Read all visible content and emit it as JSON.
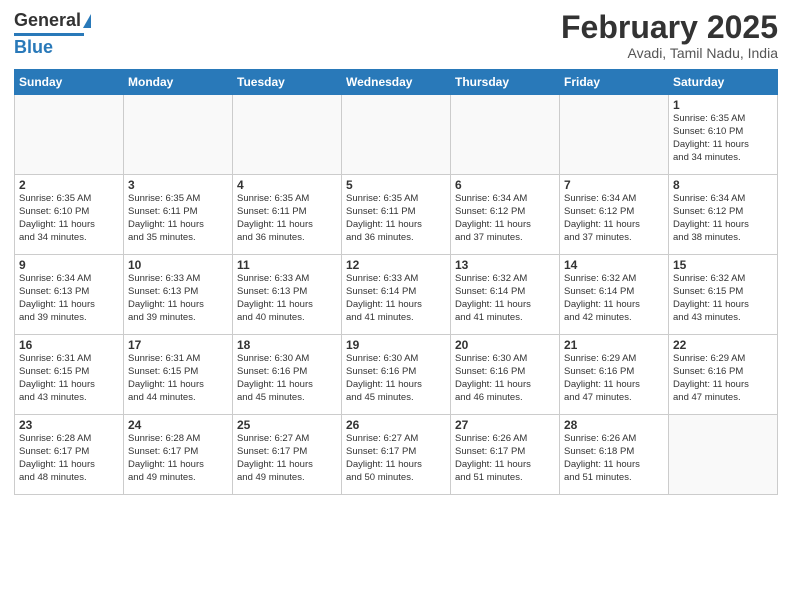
{
  "logo": {
    "general": "General",
    "blue": "Blue"
  },
  "header": {
    "month": "February 2025",
    "location": "Avadi, Tamil Nadu, India"
  },
  "days_of_week": [
    "Sunday",
    "Monday",
    "Tuesday",
    "Wednesday",
    "Thursday",
    "Friday",
    "Saturday"
  ],
  "weeks": [
    [
      {
        "day": "",
        "info": ""
      },
      {
        "day": "",
        "info": ""
      },
      {
        "day": "",
        "info": ""
      },
      {
        "day": "",
        "info": ""
      },
      {
        "day": "",
        "info": ""
      },
      {
        "day": "",
        "info": ""
      },
      {
        "day": "1",
        "info": "Sunrise: 6:35 AM\nSunset: 6:10 PM\nDaylight: 11 hours\nand 34 minutes."
      }
    ],
    [
      {
        "day": "2",
        "info": "Sunrise: 6:35 AM\nSunset: 6:10 PM\nDaylight: 11 hours\nand 34 minutes."
      },
      {
        "day": "3",
        "info": "Sunrise: 6:35 AM\nSunset: 6:11 PM\nDaylight: 11 hours\nand 35 minutes."
      },
      {
        "day": "4",
        "info": "Sunrise: 6:35 AM\nSunset: 6:11 PM\nDaylight: 11 hours\nand 36 minutes."
      },
      {
        "day": "5",
        "info": "Sunrise: 6:35 AM\nSunset: 6:11 PM\nDaylight: 11 hours\nand 36 minutes."
      },
      {
        "day": "6",
        "info": "Sunrise: 6:34 AM\nSunset: 6:12 PM\nDaylight: 11 hours\nand 37 minutes."
      },
      {
        "day": "7",
        "info": "Sunrise: 6:34 AM\nSunset: 6:12 PM\nDaylight: 11 hours\nand 37 minutes."
      },
      {
        "day": "8",
        "info": "Sunrise: 6:34 AM\nSunset: 6:12 PM\nDaylight: 11 hours\nand 38 minutes."
      }
    ],
    [
      {
        "day": "9",
        "info": "Sunrise: 6:34 AM\nSunset: 6:13 PM\nDaylight: 11 hours\nand 39 minutes."
      },
      {
        "day": "10",
        "info": "Sunrise: 6:33 AM\nSunset: 6:13 PM\nDaylight: 11 hours\nand 39 minutes."
      },
      {
        "day": "11",
        "info": "Sunrise: 6:33 AM\nSunset: 6:13 PM\nDaylight: 11 hours\nand 40 minutes."
      },
      {
        "day": "12",
        "info": "Sunrise: 6:33 AM\nSunset: 6:14 PM\nDaylight: 11 hours\nand 41 minutes."
      },
      {
        "day": "13",
        "info": "Sunrise: 6:32 AM\nSunset: 6:14 PM\nDaylight: 11 hours\nand 41 minutes."
      },
      {
        "day": "14",
        "info": "Sunrise: 6:32 AM\nSunset: 6:14 PM\nDaylight: 11 hours\nand 42 minutes."
      },
      {
        "day": "15",
        "info": "Sunrise: 6:32 AM\nSunset: 6:15 PM\nDaylight: 11 hours\nand 43 minutes."
      }
    ],
    [
      {
        "day": "16",
        "info": "Sunrise: 6:31 AM\nSunset: 6:15 PM\nDaylight: 11 hours\nand 43 minutes."
      },
      {
        "day": "17",
        "info": "Sunrise: 6:31 AM\nSunset: 6:15 PM\nDaylight: 11 hours\nand 44 minutes."
      },
      {
        "day": "18",
        "info": "Sunrise: 6:30 AM\nSunset: 6:16 PM\nDaylight: 11 hours\nand 45 minutes."
      },
      {
        "day": "19",
        "info": "Sunrise: 6:30 AM\nSunset: 6:16 PM\nDaylight: 11 hours\nand 45 minutes."
      },
      {
        "day": "20",
        "info": "Sunrise: 6:30 AM\nSunset: 6:16 PM\nDaylight: 11 hours\nand 46 minutes."
      },
      {
        "day": "21",
        "info": "Sunrise: 6:29 AM\nSunset: 6:16 PM\nDaylight: 11 hours\nand 47 minutes."
      },
      {
        "day": "22",
        "info": "Sunrise: 6:29 AM\nSunset: 6:16 PM\nDaylight: 11 hours\nand 47 minutes."
      }
    ],
    [
      {
        "day": "23",
        "info": "Sunrise: 6:28 AM\nSunset: 6:17 PM\nDaylight: 11 hours\nand 48 minutes."
      },
      {
        "day": "24",
        "info": "Sunrise: 6:28 AM\nSunset: 6:17 PM\nDaylight: 11 hours\nand 49 minutes."
      },
      {
        "day": "25",
        "info": "Sunrise: 6:27 AM\nSunset: 6:17 PM\nDaylight: 11 hours\nand 49 minutes."
      },
      {
        "day": "26",
        "info": "Sunrise: 6:27 AM\nSunset: 6:17 PM\nDaylight: 11 hours\nand 50 minutes."
      },
      {
        "day": "27",
        "info": "Sunrise: 6:26 AM\nSunset: 6:17 PM\nDaylight: 11 hours\nand 51 minutes."
      },
      {
        "day": "28",
        "info": "Sunrise: 6:26 AM\nSunset: 6:18 PM\nDaylight: 11 hours\nand 51 minutes."
      },
      {
        "day": "",
        "info": ""
      }
    ]
  ]
}
